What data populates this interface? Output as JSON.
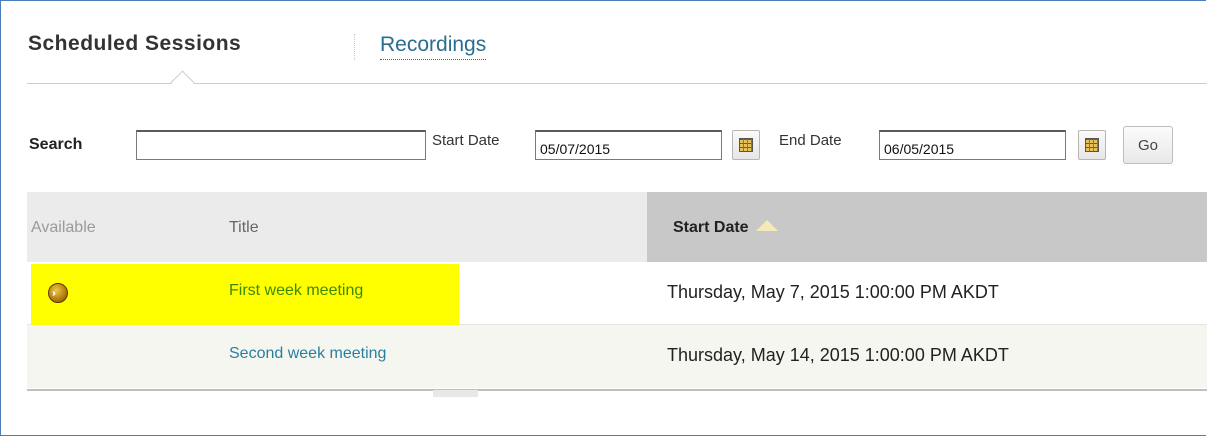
{
  "tabs": {
    "active": "Scheduled Sessions",
    "other": "Recordings"
  },
  "search": {
    "label": "Search",
    "value": "",
    "start_date_label": "Start Date",
    "start_date_value": "05/07/2015",
    "end_date_label": "End Date",
    "end_date_value": "06/05/2015",
    "go_label": "Go",
    "calendar_icon": "calendar-icon"
  },
  "table": {
    "columns": [
      "Available",
      "Title",
      "Start Date"
    ],
    "sort_column": "Start Date",
    "sort_direction": "ascending",
    "rows": [
      {
        "available_icon": "go-arrow-icon",
        "title": "First week meeting",
        "start_date": "Thursday, May 7, 2015 1:00:00 PM AKDT",
        "highlighted": true
      },
      {
        "available_icon": "",
        "title": "Second week meeting",
        "start_date": "Thursday, May 14, 2015 1:00:00 PM AKDT",
        "highlighted": false
      }
    ]
  },
  "colors": {
    "highlight": "#ffff00",
    "link": "#2a7fa0",
    "link_green": "#3d8a00",
    "sorted_header": "#c8c8c8"
  }
}
